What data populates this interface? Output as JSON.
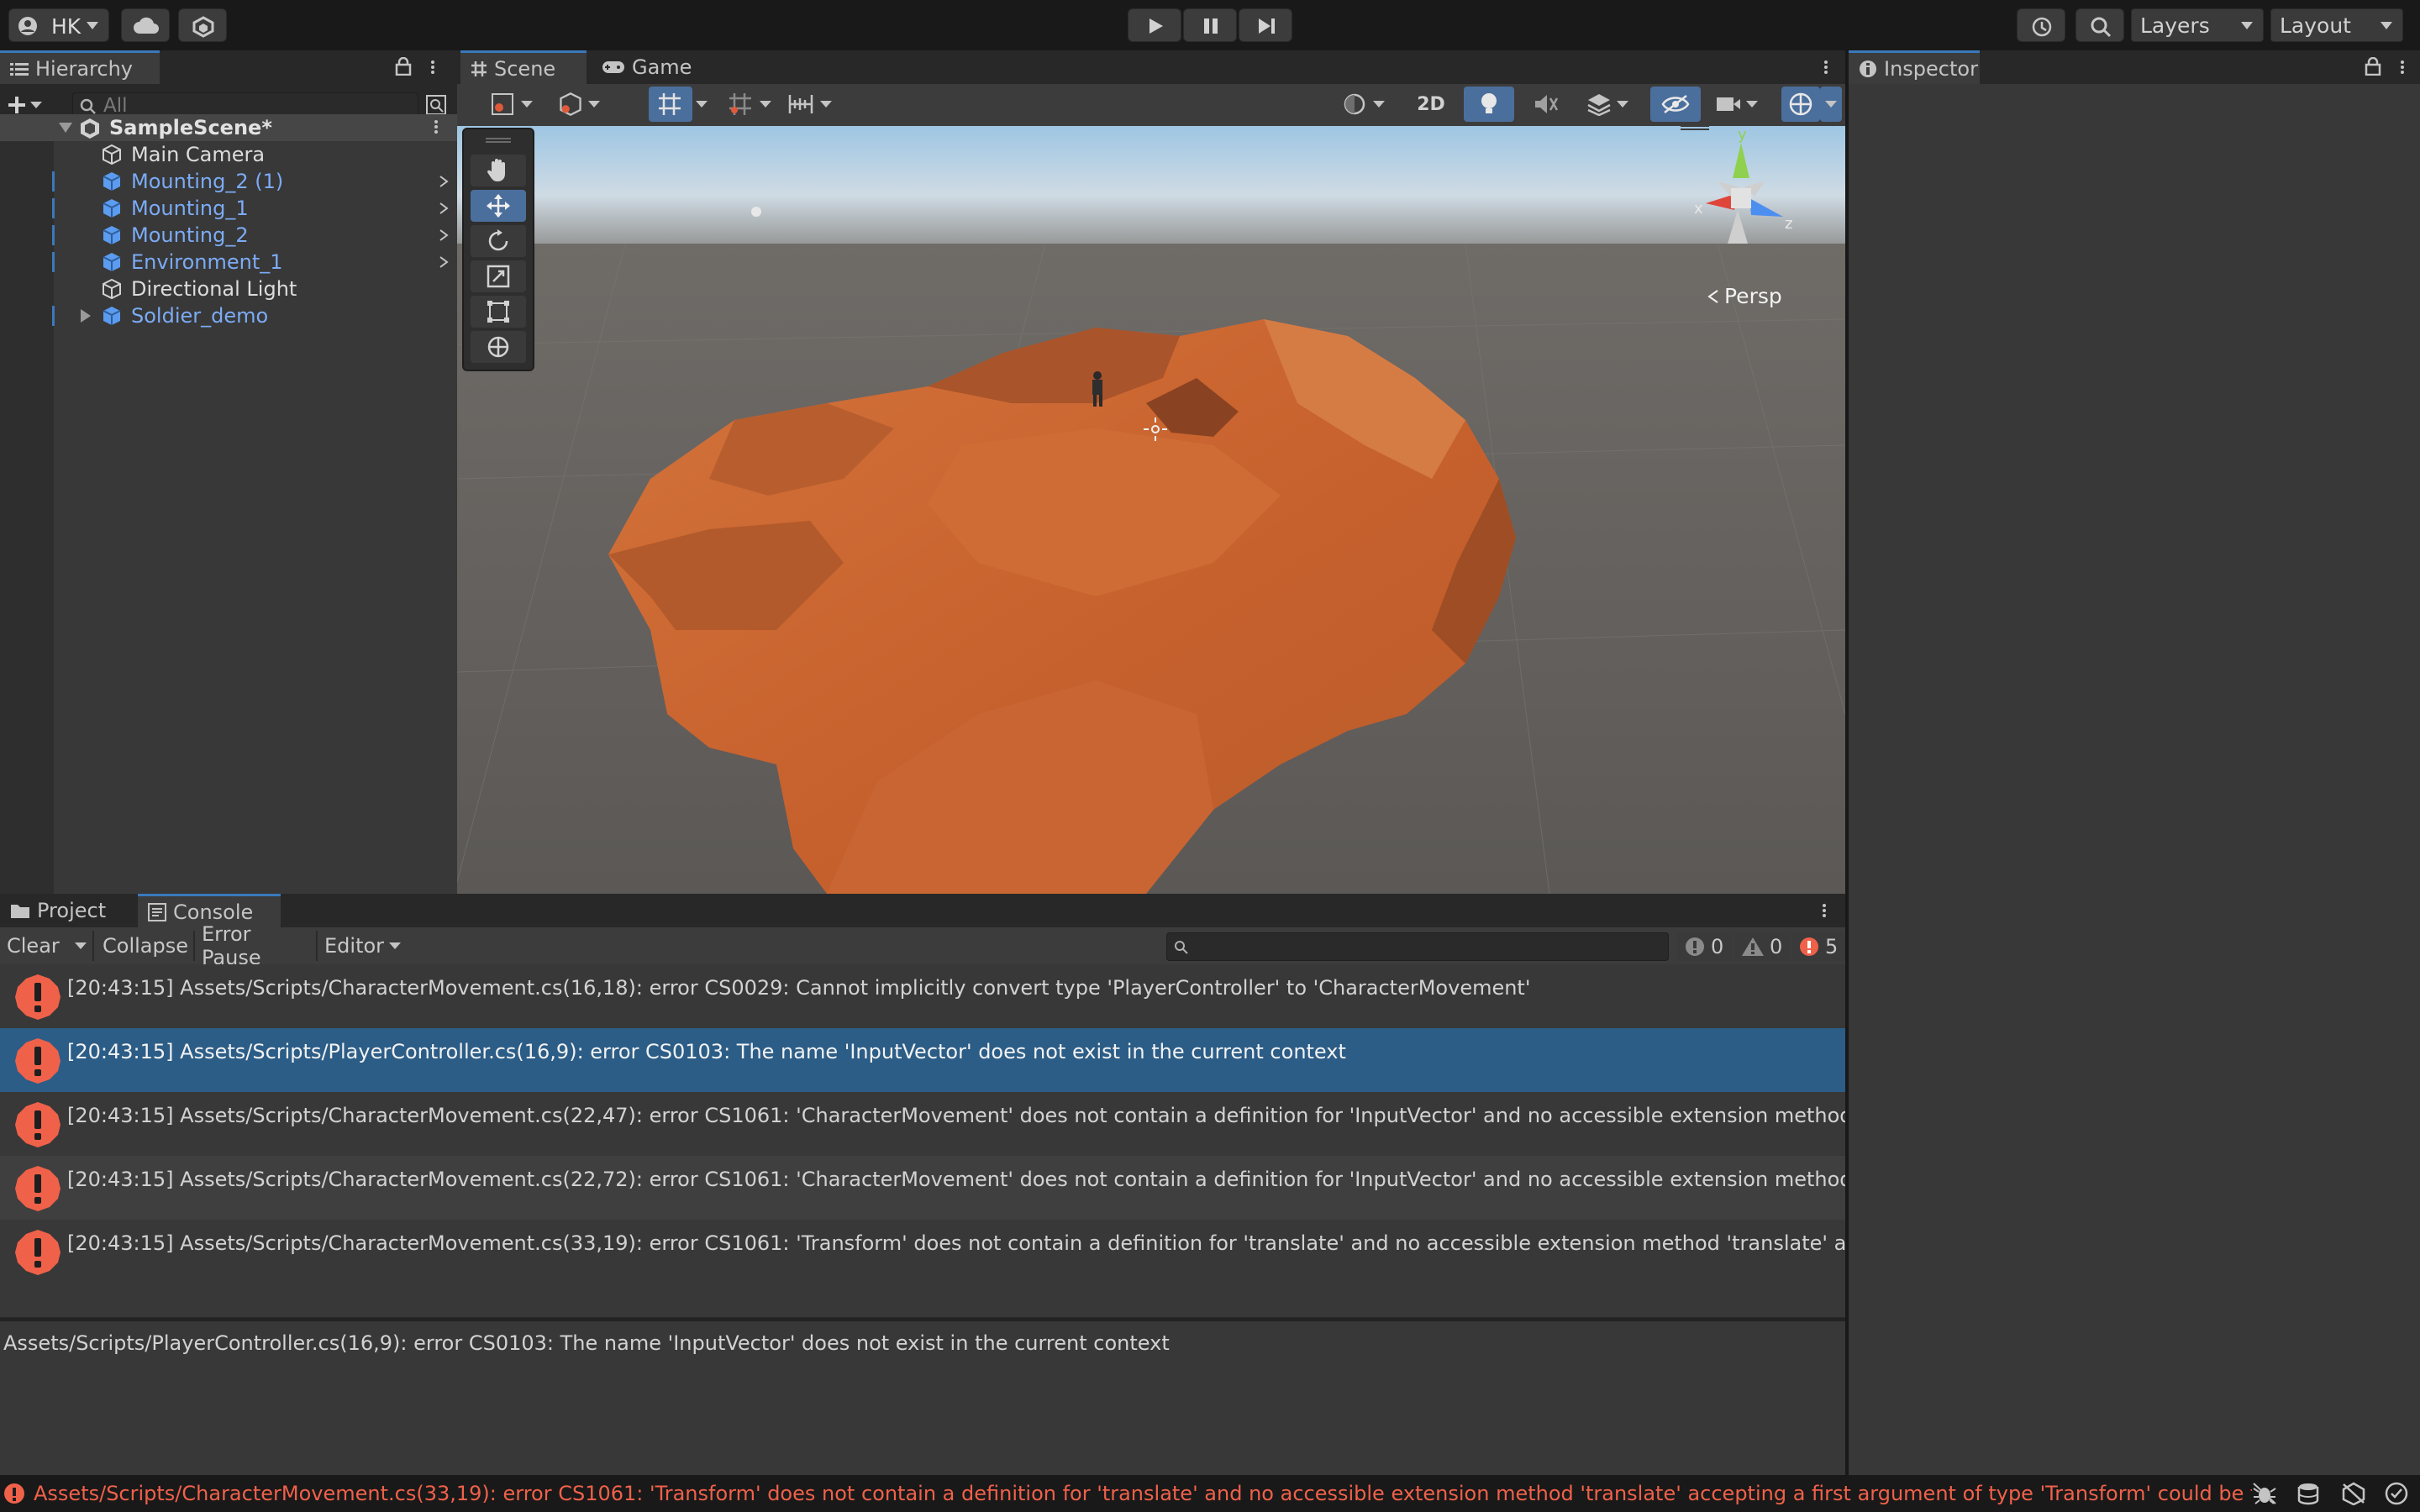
{
  "topbar": {
    "account": "HK",
    "layers_label": "Layers",
    "layout_label": "Layout"
  },
  "hierarchy": {
    "tab_label": "Hierarchy",
    "search_placeholder": "All",
    "scene_name": "SampleScene*",
    "items": [
      {
        "label": "Main Camera",
        "type": "object"
      },
      {
        "label": "Mounting_2 (1)",
        "type": "prefab"
      },
      {
        "label": "Mounting_1",
        "type": "prefab"
      },
      {
        "label": "Mounting_2",
        "type": "prefab"
      },
      {
        "label": "Environment_1",
        "type": "prefab"
      },
      {
        "label": "Directional Light",
        "type": "object"
      },
      {
        "label": "Soldier_demo",
        "type": "prefab"
      }
    ]
  },
  "scene": {
    "tabs": [
      {
        "label": "Scene"
      },
      {
        "label": "Game"
      }
    ],
    "toolbar": {
      "two_d": "2D"
    },
    "persp_label": "Persp",
    "gizmo_axes": {
      "x": "x",
      "y": "y",
      "z": "z"
    }
  },
  "inspector": {
    "tab_label": "Inspector"
  },
  "console": {
    "tabs": [
      {
        "label": "Project"
      },
      {
        "label": "Console"
      }
    ],
    "toolbar": {
      "clear": "Clear",
      "collapse": "Collapse",
      "error_pause": "Error Pause",
      "editor": "Editor"
    },
    "counts": {
      "info": "0",
      "warnings": "0",
      "errors": "5"
    },
    "messages": [
      {
        "text": "[20:43:15] Assets/Scripts/CharacterMovement.cs(16,18): error CS0029: Cannot implicitly convert type 'PlayerController' to 'CharacterMovement'"
      },
      {
        "text": "[20:43:15] Assets/Scripts/PlayerController.cs(16,9): error CS0103: The name 'InputVector' does not exist in the current context"
      },
      {
        "text": "[20:43:15] Assets/Scripts/CharacterMovement.cs(22,47): error CS1061: 'CharacterMovement' does not contain a definition for 'InputVector' and no accessible extension method 'InputVector'"
      },
      {
        "text": "[20:43:15] Assets/Scripts/CharacterMovement.cs(22,72): error CS1061: 'CharacterMovement' does not contain a definition for 'InputVector' and no accessible extension method 'InputVector'"
      },
      {
        "text": "[20:43:15] Assets/Scripts/CharacterMovement.cs(33,19): error CS1061: 'Transform' does not contain a definition for 'translate' and no accessible extension method 'translate' accepting a first"
      }
    ],
    "selected_detail": "Assets/Scripts/PlayerController.cs(16,9): error CS0103: The name 'InputVector' does not exist in the current context"
  },
  "status_bar": {
    "message": "Assets/Scripts/CharacterMovement.cs(33,19): error CS1061: 'Transform' does not contain a definition for 'translate' and no accessible extension method 'translate' accepting a first argument of type 'Transform' could be found (are"
  },
  "colors": {
    "accent": "#3a79bb",
    "prefab_text": "#7cabf5",
    "error": "#f0614a",
    "terrain": "#c8622e"
  }
}
